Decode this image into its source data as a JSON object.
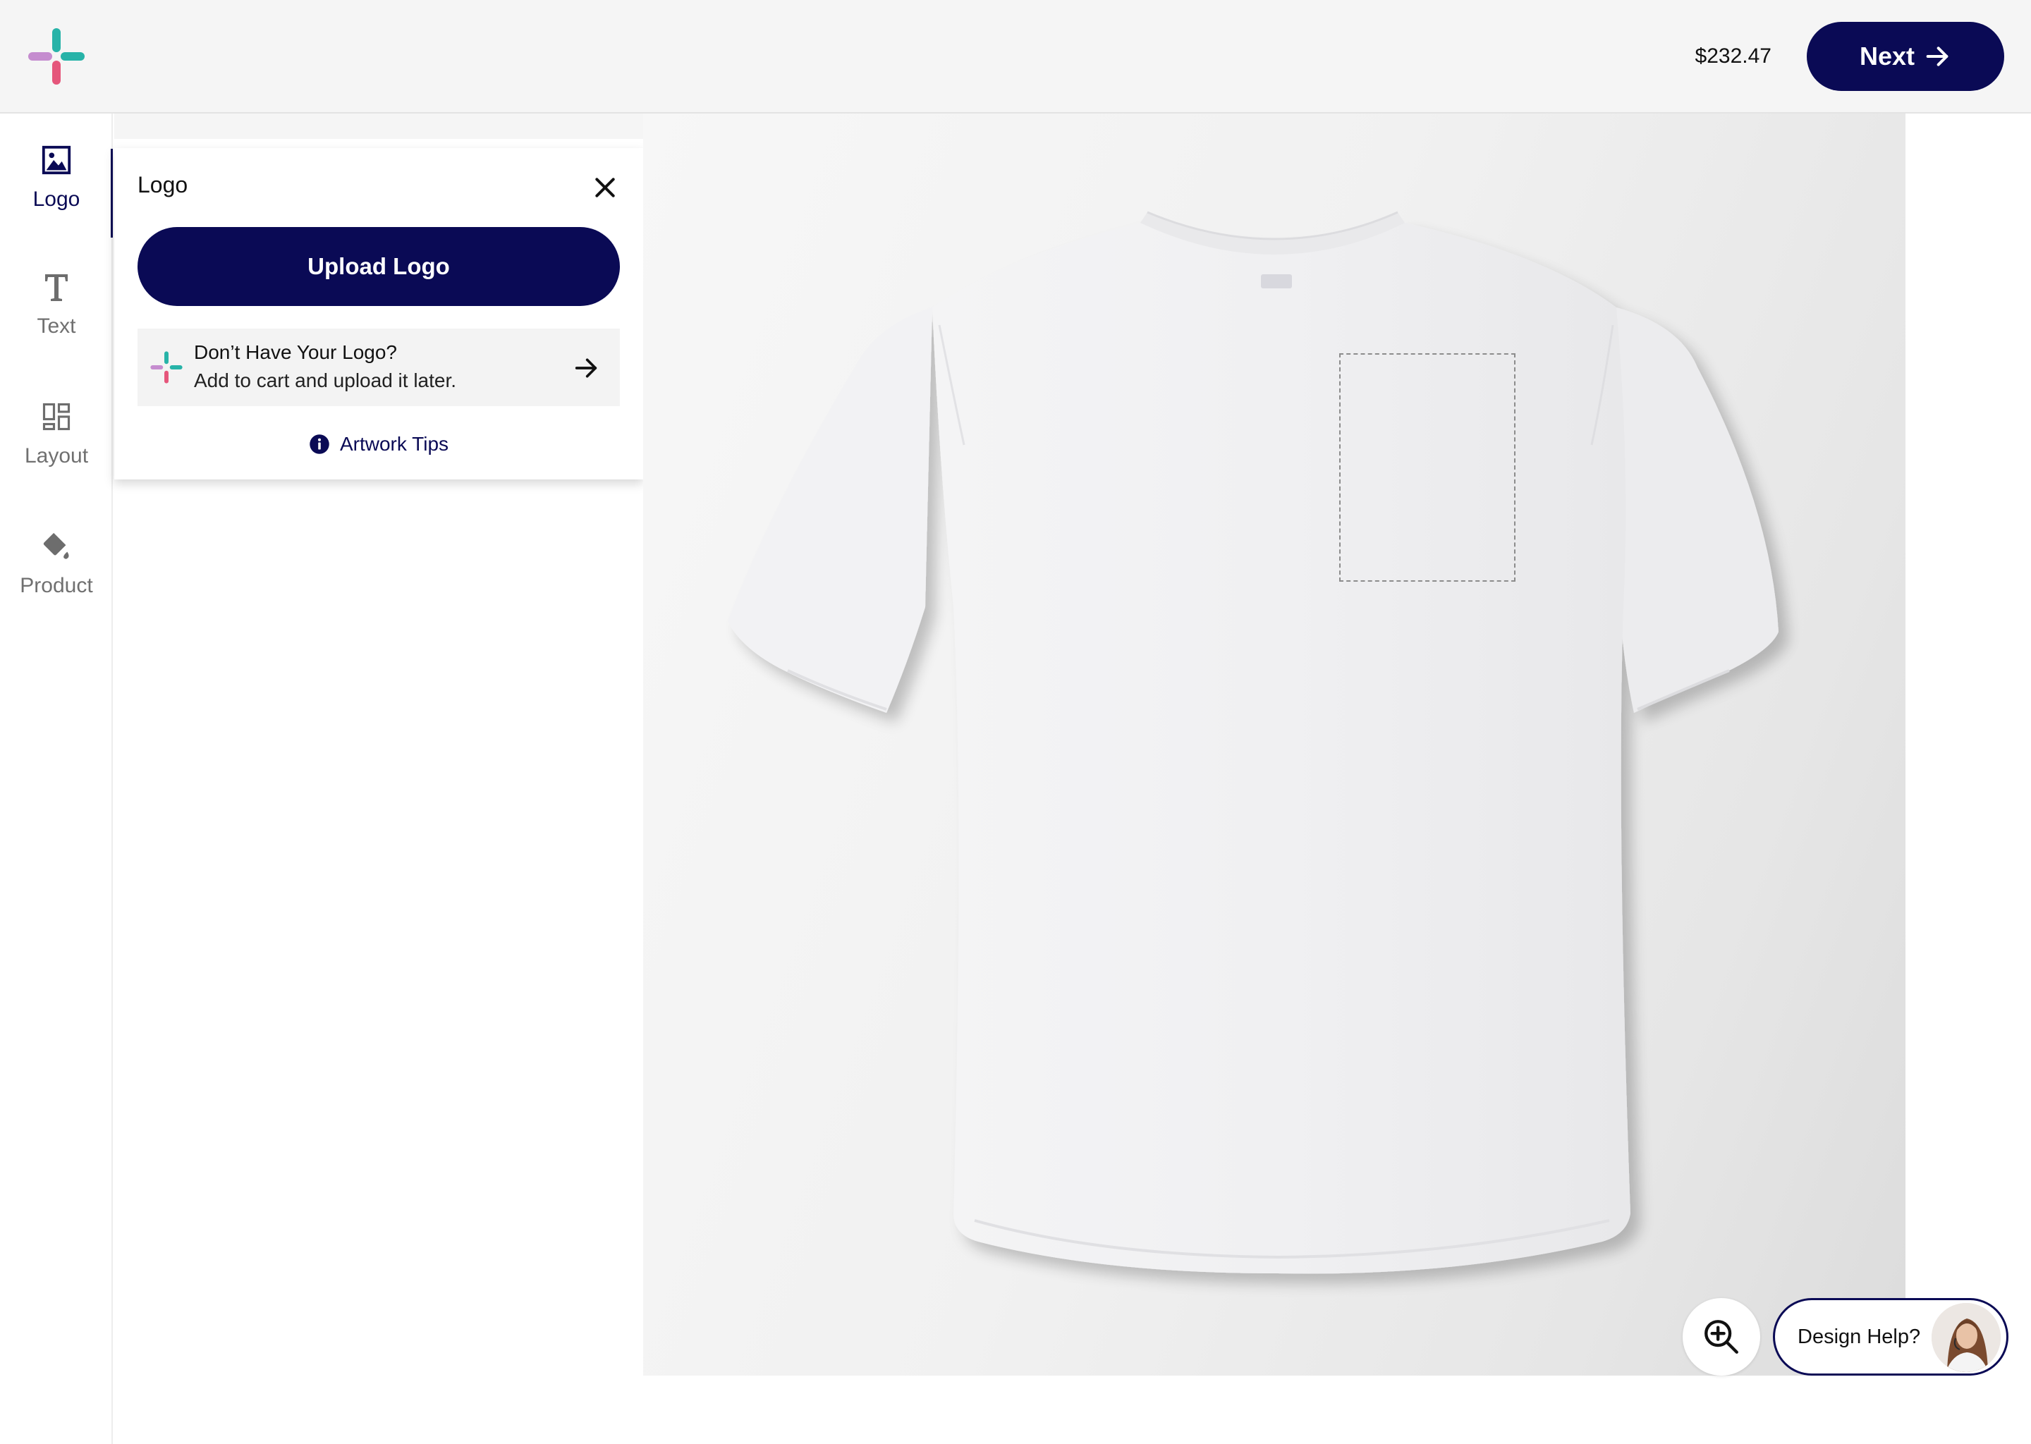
{
  "header": {
    "price": "$232.47",
    "next_label": "Next"
  },
  "rail": {
    "items": [
      {
        "label": "Logo",
        "icon": "image-icon",
        "active": true
      },
      {
        "label": "Text",
        "icon": "text-icon",
        "active": false
      },
      {
        "label": "Layout",
        "icon": "layout-icon",
        "active": false
      },
      {
        "label": "Product",
        "icon": "paint-bucket-icon",
        "active": false
      }
    ]
  },
  "panel": {
    "title": "Logo",
    "upload_label": "Upload Logo",
    "no_logo_title": "Don’t Have Your Logo?",
    "no_logo_subtitle": "Add to cart and upload it later.",
    "tips_label": "Artwork Tips"
  },
  "controls": {
    "design_help_label": "Design Help?"
  },
  "colors": {
    "brand_navy": "#0a0a55",
    "mark_teal": "#27b3a8",
    "mark_pink": "#e5567b",
    "mark_purple": "#c58ccf"
  }
}
